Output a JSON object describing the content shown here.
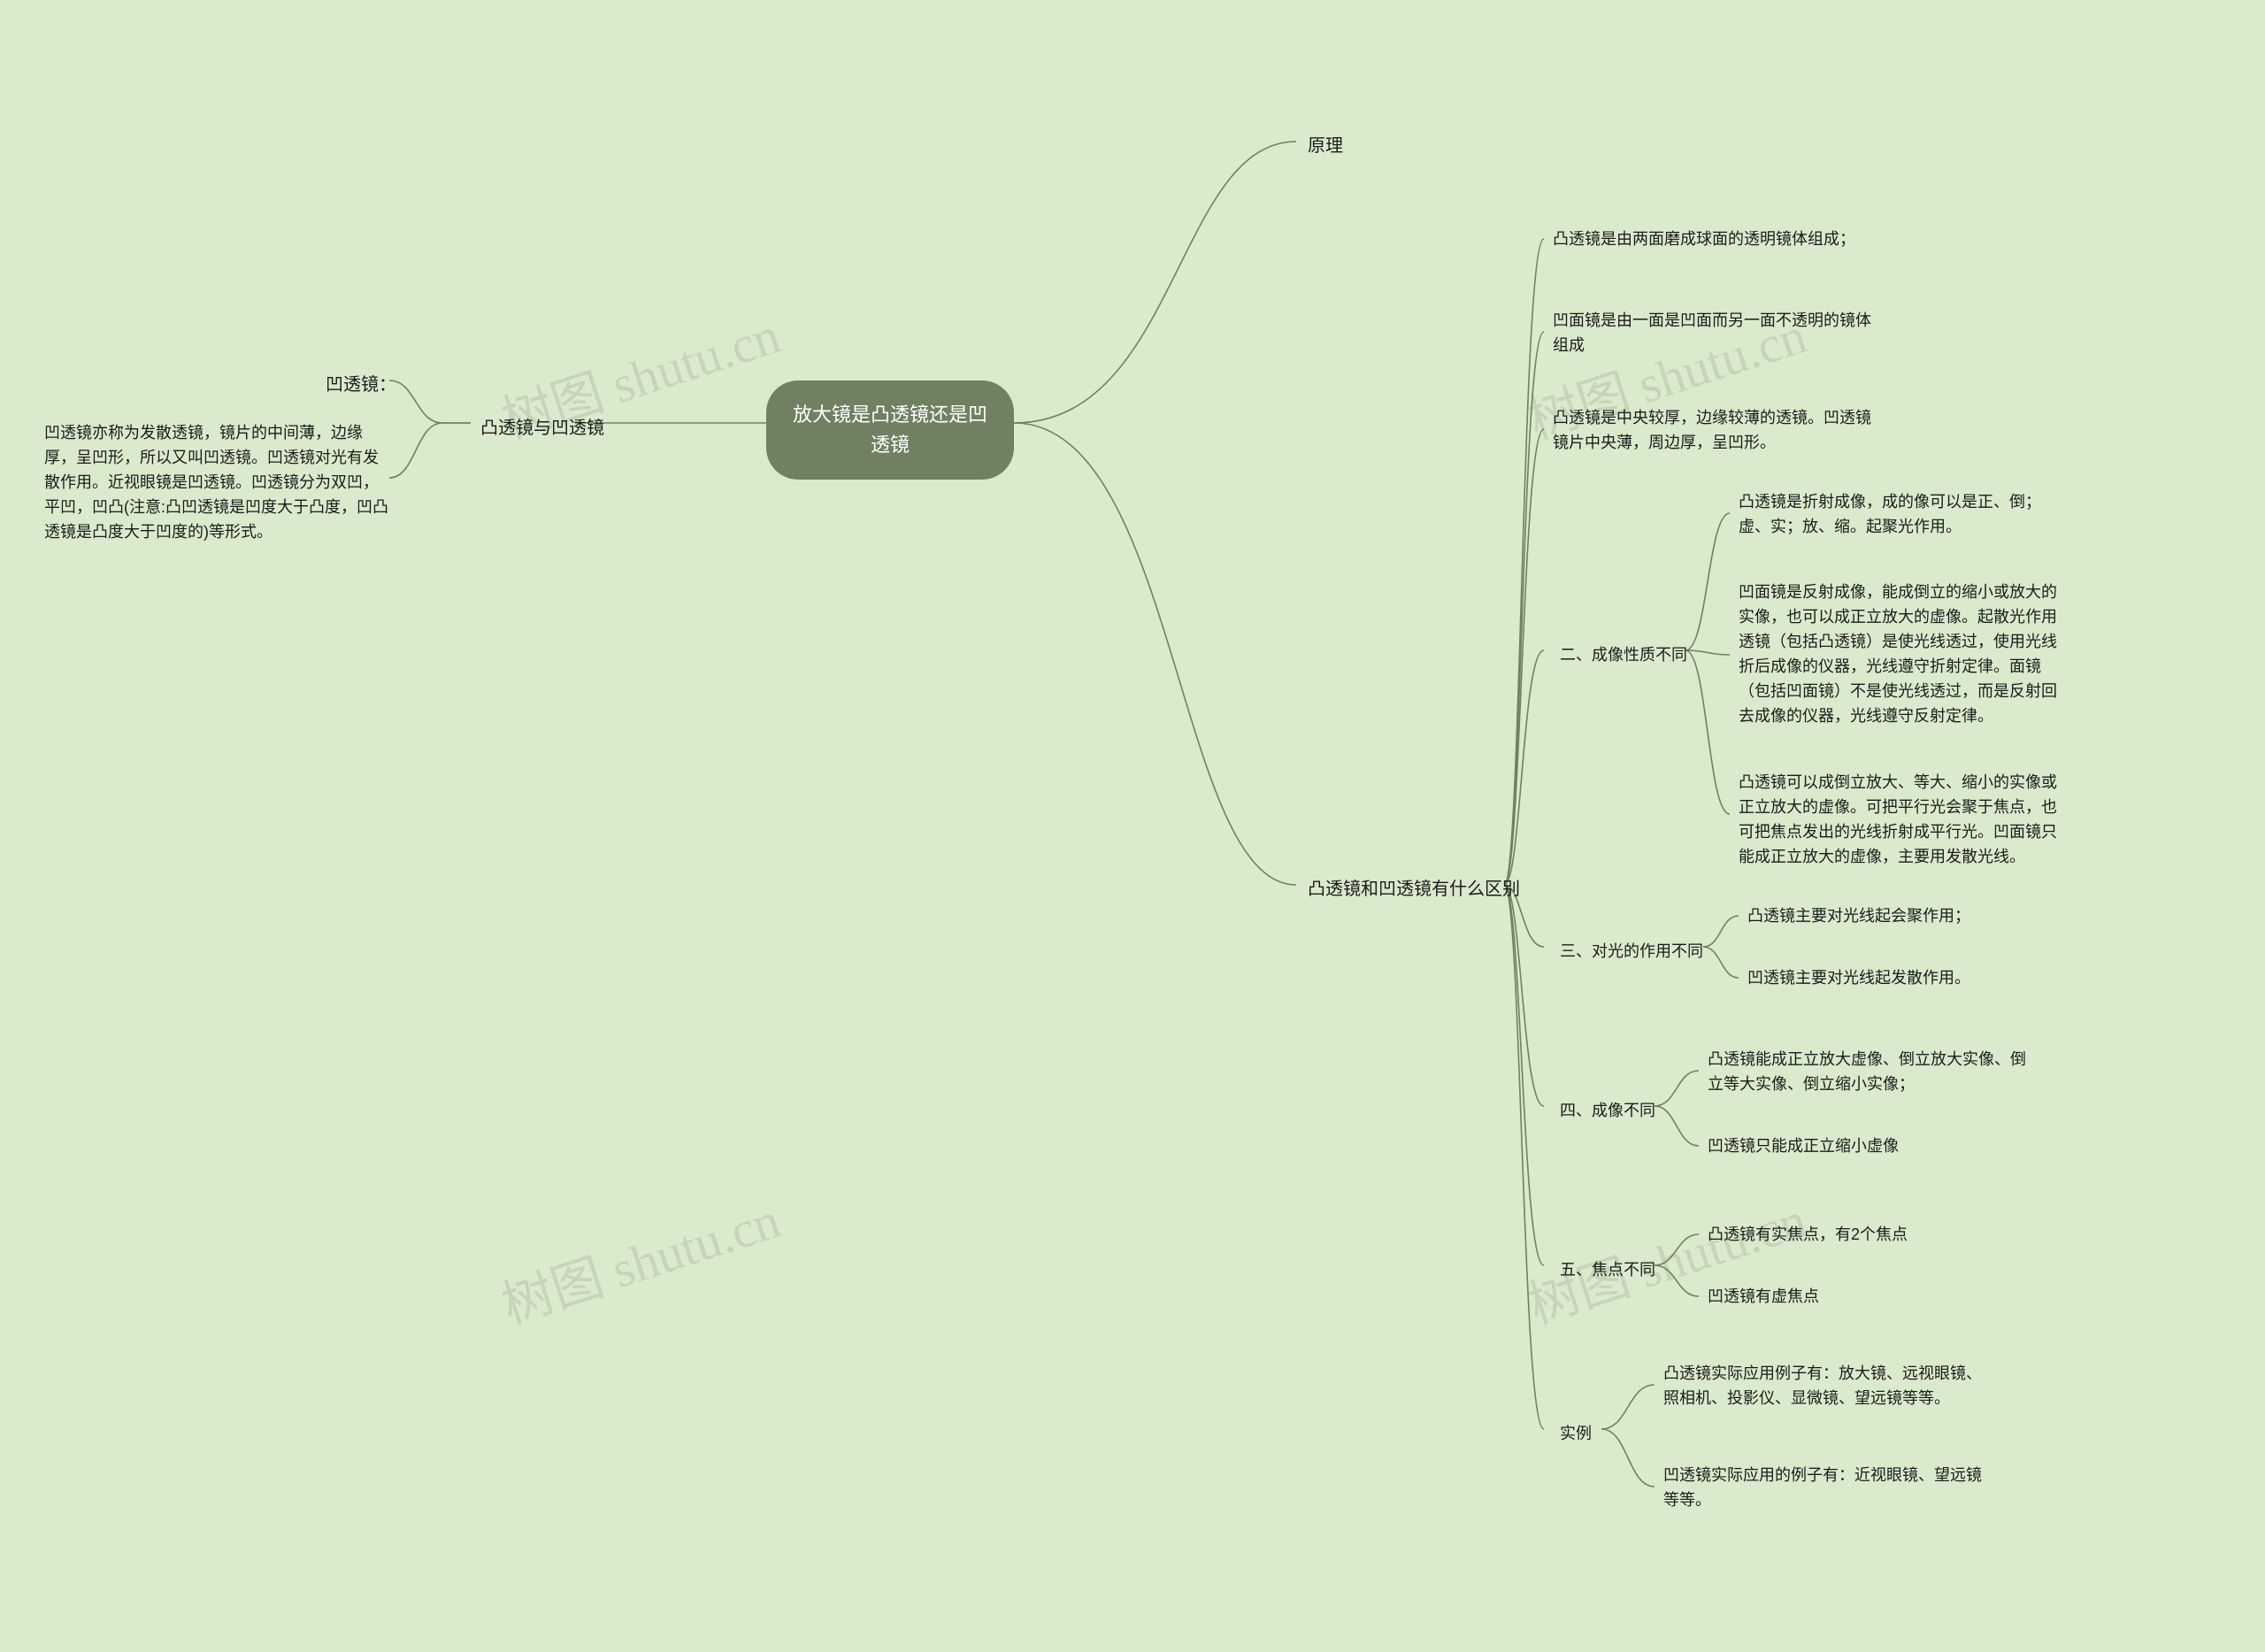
{
  "watermark": "树图 shutu.cn",
  "central": "放大镜是凸透镜还是凹透镜",
  "left": {
    "l1": "凸透镜与凹透镜",
    "l2": "凹透镜：",
    "l3": "凹透镜亦称为发散透镜，镜片的中间薄，边缘厚，呈凹形，所以又叫凹透镜。凹透镜对光有发散作用。近视眼镜是凹透镜。凹透镜分为双凹，平凹，凹凸(注意:凸凹透镜是凹度大于凸度，凹凸透镜是凸度大于凹度的)等形式。"
  },
  "right": {
    "r1": "原理",
    "r2": "凸透镜和凹透镜有什么区别",
    "a1": "凸透镜是由两面磨成球面的透明镜体组成；",
    "a2": "凹面镜是由一面是凹面而另一面不透明的镜体组成",
    "a3": "凸透镜是中央较厚，边缘较薄的透镜。凹透镜镜片中央薄，周边厚，呈凹形。",
    "b_label": "二、成像性质不同",
    "b1": "凸透镜是折射成像，成的像可以是正、倒；虚、实；放、缩。起聚光作用。",
    "b2": "凹面镜是反射成像，能成倒立的缩小或放大的实像，也可以成正立放大的虚像。起散光作用透镜（包括凸透镜）是使光线透过，使用光线折后成像的仪器，光线遵守折射定律。面镜（包括凹面镜）不是使光线透过，而是反射回去成像的仪器，光线遵守反射定律。",
    "b3": "凸透镜可以成倒立放大、等大、缩小的实像或正立放大的虚像。可把平行光会聚于焦点，也可把焦点发出的光线折射成平行光。凹面镜只能成正立放大的虚像，主要用发散光线。",
    "c_label": "三、对光的作用不同",
    "c1": "凸透镜主要对光线起会聚作用；",
    "c2": "凹透镜主要对光线起发散作用。",
    "d_label": "四、成像不同",
    "d1": "凸透镜能成正立放大虚像、倒立放大实像、倒立等大实像、倒立缩小实像；",
    "d2": "凹透镜只能成正立缩小虚像",
    "e_label": "五、焦点不同",
    "e1": "凸透镜有实焦点，有2个焦点",
    "e2": "凹透镜有虚焦点",
    "f_label": "实例",
    "f1": "凸透镜实际应用例子有：放大镜、远视眼镜、照相机、投影仪、显微镜、望远镜等等。",
    "f2": "凹透镜实际应用的例子有：近视眼镜、望远镜等等。"
  }
}
